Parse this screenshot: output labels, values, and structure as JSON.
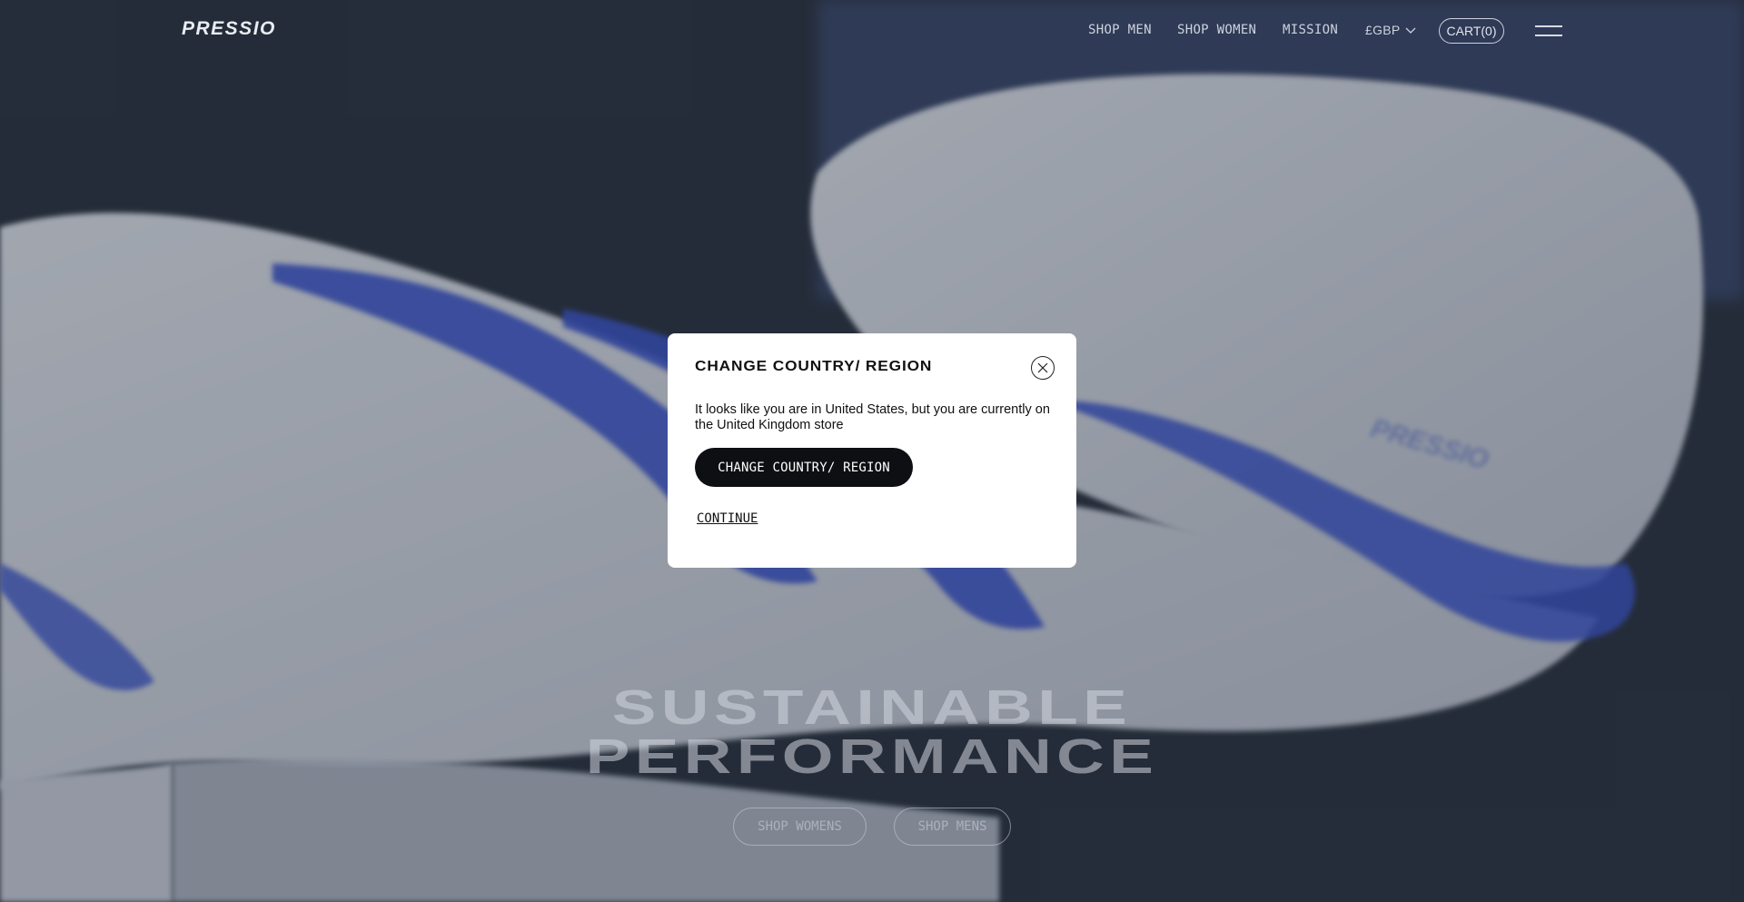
{
  "brand": {
    "logo_text": "PRESSIO"
  },
  "nav": {
    "items": [
      {
        "label": "SHOP MEN"
      },
      {
        "label": "SHOP WOMEN"
      },
      {
        "label": "MISSION"
      }
    ],
    "currency": "£GBP",
    "cart_label": "CART(0)"
  },
  "hero": {
    "title_line1": "SUSTAINABLE",
    "title_line2": "PERFORMANCE",
    "buttons": [
      {
        "label": "SHOP WOMENS"
      },
      {
        "label": "SHOP MENS"
      }
    ]
  },
  "modal": {
    "title": "CHANGE COUNTRY/ REGION",
    "message": "It looks like you are in United States, but you are currently on the United Kingdom store",
    "primary_label": "CHANGE COUNTRY/ REGION",
    "continue_label": "CONTINUE"
  },
  "colors": {
    "accent_blue": "#2a47c9",
    "modal_button": "#0d0f12"
  }
}
